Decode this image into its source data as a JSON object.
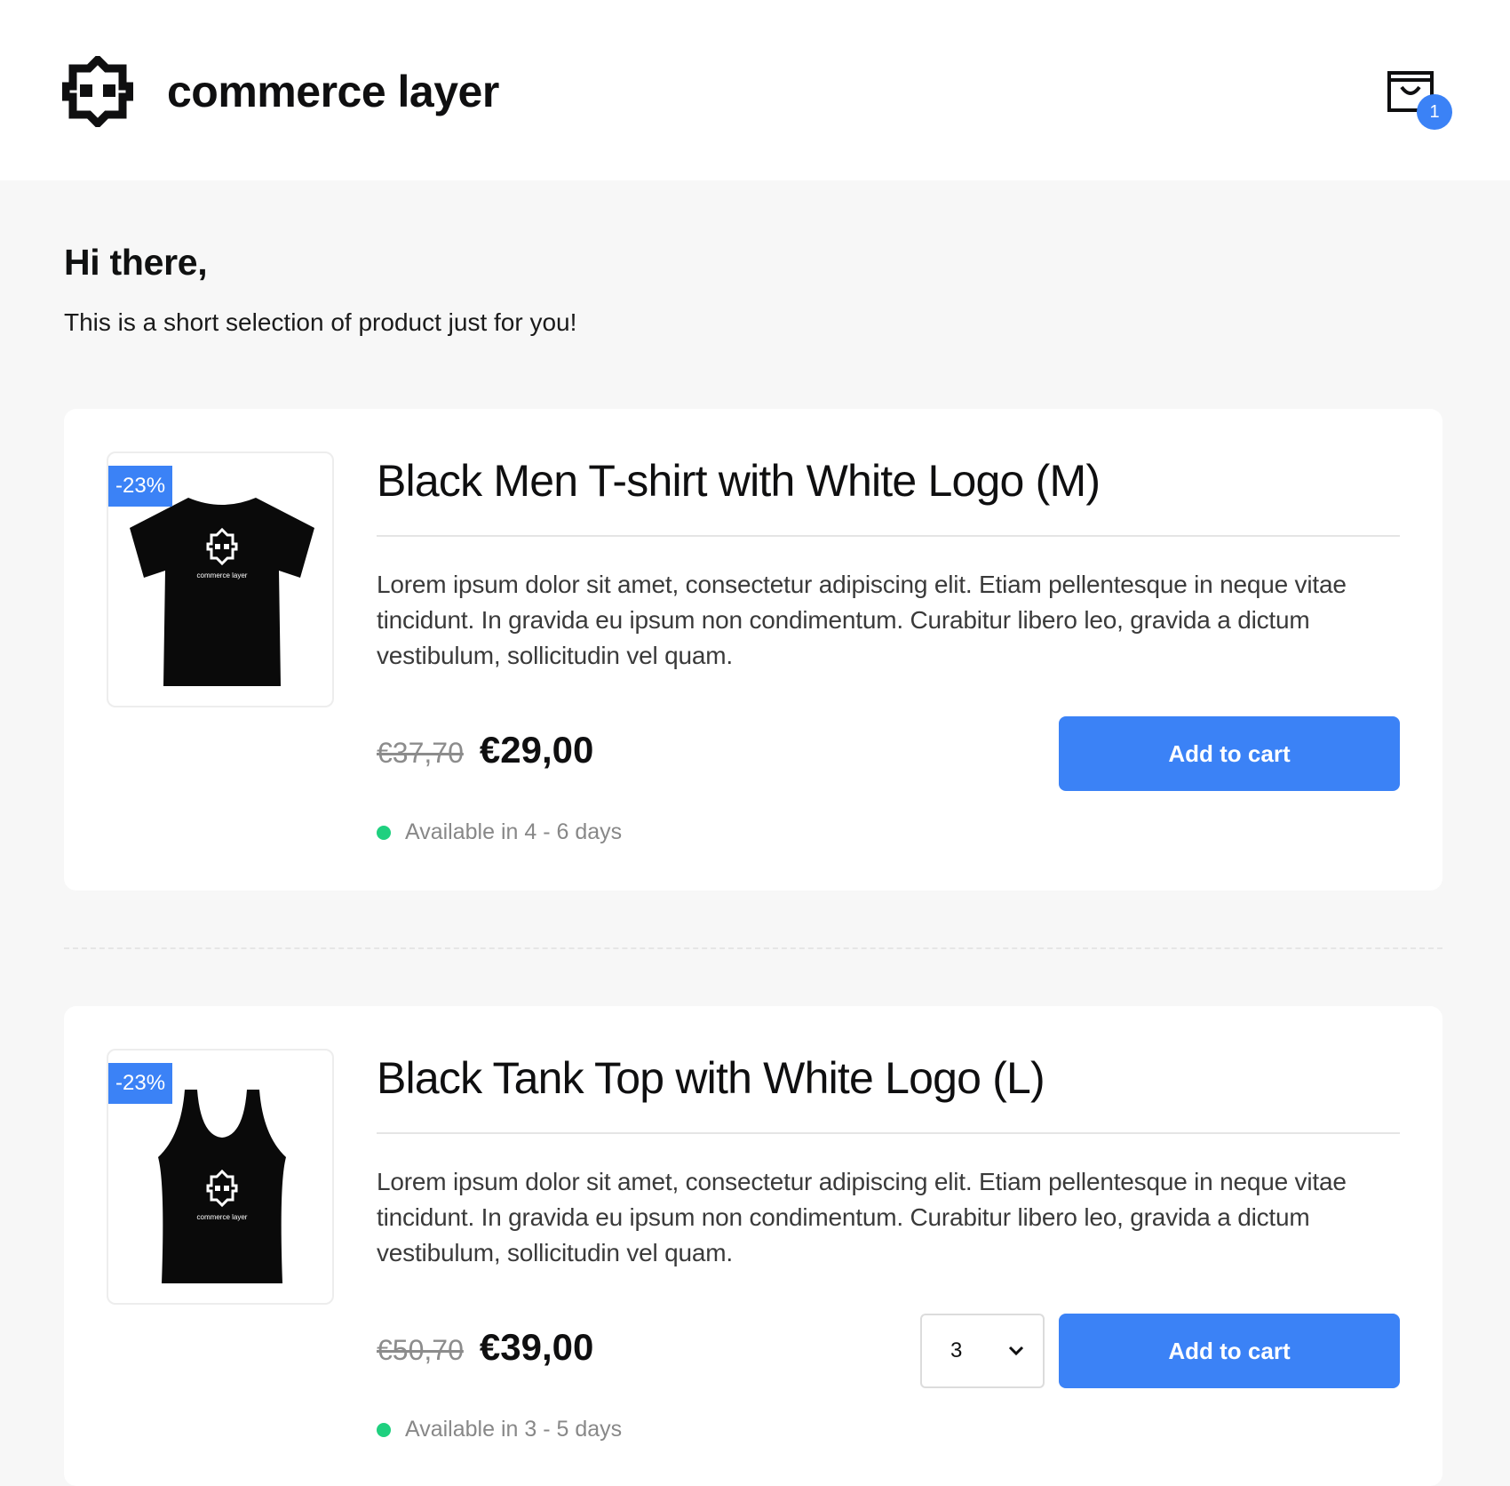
{
  "brand": {
    "name": "commerce layer"
  },
  "cart": {
    "count": "1",
    "icon": "shopping-bag-icon"
  },
  "intro": {
    "heading": "Hi there,",
    "subtitle": "This is a short selection of product just for you!"
  },
  "colors": {
    "accent": "#3b82f6",
    "available": "#1fd07f"
  },
  "products": [
    {
      "title": "Black Men T-shirt with White Logo (M)",
      "discount": "-23%",
      "description": "Lorem ipsum dolor sit amet, consectetur adipiscing elit. Etiam pellentesque in neque vitae tincidunt. In gravida eu ipsum non condimentum. Curabitur libero leo, gravida a dictum vestibulum, sollicitudin vel quam.",
      "old_price": "€37,70",
      "price": "€29,00",
      "button_label": "Add to cart",
      "availability": "Available in 4 - 6 days",
      "image_logo_text": "commerce layer"
    },
    {
      "title": "Black Tank Top with White Logo (L)",
      "discount": "-23%",
      "description": "Lorem ipsum dolor sit amet, consectetur adipiscing elit. Etiam pellentesque in neque vitae tincidunt. In gravida eu ipsum non condimentum. Curabitur libero leo, gravida a dictum vestibulum, sollicitudin vel quam.",
      "old_price": "€50,70",
      "price": "€39,00",
      "quantity": "3",
      "button_label": "Add to cart",
      "availability": "Available in 3 - 5 days",
      "image_logo_text": "commerce layer"
    }
  ]
}
